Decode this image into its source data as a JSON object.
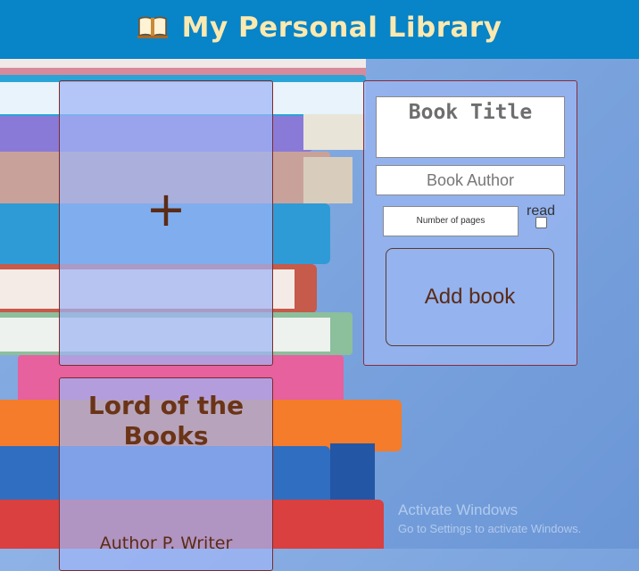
{
  "header": {
    "title": "My Personal Library",
    "icon": "open-book-icon"
  },
  "new_book_card": {
    "icon": "plus-icon",
    "glyph": "+"
  },
  "books": [
    {
      "title": "Lord of the Books",
      "author": "Author P. Writer"
    }
  ],
  "form": {
    "title_placeholder": "Book Title",
    "author_placeholder": "Book Author",
    "pages_placeholder": "Number of pages",
    "read_label": "read",
    "read_checked": false,
    "submit_label": "Add book"
  },
  "watermark": {
    "line1": "Activate Windows",
    "line2": "Go to Settings to activate Windows."
  },
  "colors": {
    "header_bg": "#0884c8",
    "header_text": "#fbe9b0",
    "card_text": "#6b3417",
    "card_border": "#7b2c2c"
  }
}
